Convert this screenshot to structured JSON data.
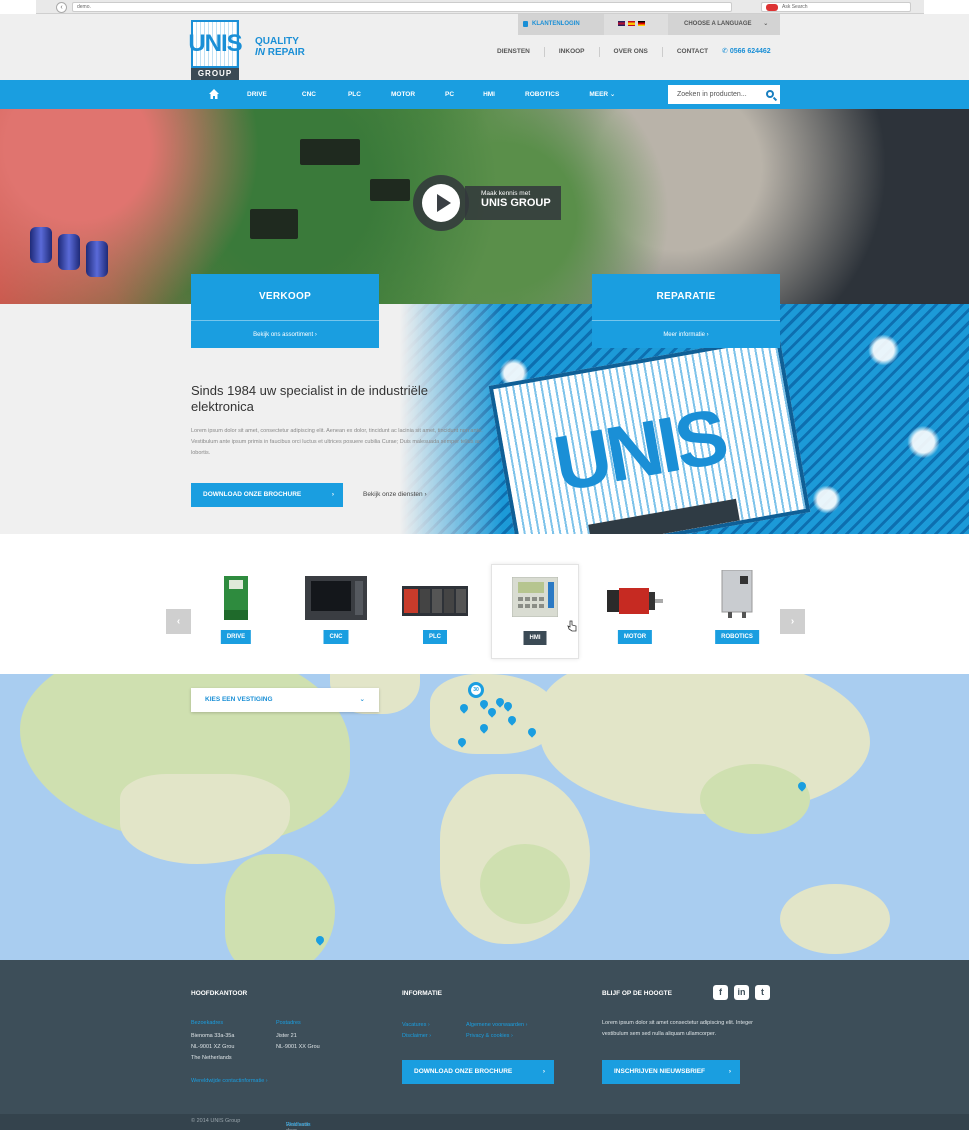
{
  "browser": {
    "address": "demo.",
    "search_placeholder": "Ask Search",
    "back": "‹"
  },
  "brand": {
    "logo_text": "UNIS",
    "logo_sub": "GROUP",
    "tagline_1": "QUALITY",
    "tagline_2a": "IN",
    "tagline_2b": "REPAIR"
  },
  "topbar": {
    "login": "KLANTENLOGIN",
    "language": "CHOOSE A LANGUAGE"
  },
  "subnav": [
    "DIENSTEN",
    "INKOOP",
    "OVER ONS",
    "CONTACT"
  ],
  "phone": "0566 624462",
  "mainnav": {
    "items": [
      "DRIVE",
      "CNC",
      "PLC",
      "MOTOR",
      "PC",
      "HMI",
      "ROBOTICS",
      "MEER"
    ],
    "search_placeholder": "Zoeken in producten..."
  },
  "hero": {
    "video_line1": "Maak kennis met",
    "video_line2": "UNIS GROUP",
    "card_left": {
      "title": "VERKOOP",
      "sub": "Bekijk ons assortiment"
    },
    "card_right": {
      "title": "REPARATIE",
      "sub": "Meer informatie"
    },
    "heading": "Sinds 1984 uw specialist in de industriële elektronica",
    "body": "Lorem ipsum dolor sit amet, consectetur adipiscing elit. Aenean ex dolor, tincidunt ac lacinia sit amet, tincidunt non ante. Vestibulum ante ipsum primis in faucibus orci luctus et ultrices posuere cubilia Curae; Duis malesuada semper tellus ac lobortis.",
    "download_button": "DOWNLOAD ONZE BROCHURE",
    "services_link": "Bekijk onze diensten",
    "chip_text": "UNIS"
  },
  "products": [
    "DRIVE",
    "CNC",
    "PLC",
    "HMI",
    "MOTOR",
    "ROBOTICS"
  ],
  "map": {
    "select_label": "KIES EEN VESTIGING",
    "cluster_count": "30"
  },
  "footer": {
    "hq_title": "HOOFDKANTOOR",
    "visit_label": "Bezoekadres",
    "visit_lines": [
      "Bienoma 33a-35a",
      "NL-9001 XZ Grou",
      "The Netherlands"
    ],
    "post_label": "Postadres",
    "post_lines": [
      "Jister 21",
      "NL-9001 XX Grou"
    ],
    "contact_link": "Wereldwijde contactinformatie",
    "info_title": "INFORMATIE",
    "info_links": [
      "Vacatures",
      "Algemene voorwaarden",
      "Disclaimer",
      "Privacy & cookies"
    ],
    "download_button": "DOWNLOAD ONZE BROCHURE",
    "news_title": "BLIJF OP DE HOOGTE",
    "news_text": "Lorem ipsum dolor sit amet consectetur adipiscing elit. Integer vestibulum sem sed nulla aliquam ullamcorper.",
    "newsletter_button": "INSCHRIJVEN NIEUWSBRIEF",
    "copyright": "© 2014 UNIS Group",
    "credit_prefix": "Realisatie door",
    "credit_name": "Webfeeds"
  },
  "colors": {
    "accent": "#1a9ee0",
    "dark": "#3d4e59",
    "header_bg": "#efefef"
  }
}
